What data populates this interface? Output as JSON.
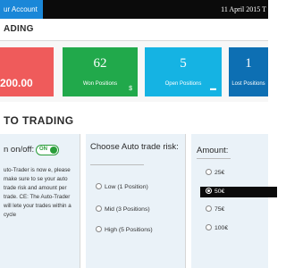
{
  "topbar": {
    "account_tab": "ur Account",
    "date": "11 April 2015 T"
  },
  "section1": {
    "title": "ADING"
  },
  "stats": {
    "balance": "200.00",
    "won": {
      "value": "62",
      "label": "Won Positions"
    },
    "open": {
      "value": "5",
      "label": "Open Positions"
    },
    "lost": {
      "value": "1",
      "label": "Lost Positions"
    }
  },
  "section2": {
    "title": "TO TRADING"
  },
  "autotrader": {
    "title": "n on/off:",
    "toggle_label": "ON",
    "text": "uto-Trader is now e, please make sure to se your auto trade risk and amount per trade. CE: The Auto-Trader will lete your trades within a cycle"
  },
  "risk": {
    "title": "Choose Auto trade risk:",
    "options": [
      {
        "label": "Low (1 Position)",
        "selected": false
      },
      {
        "label": "Mid (3 Positions)",
        "selected": false
      },
      {
        "label": "High (5 Positions)",
        "selected": false
      }
    ]
  },
  "amount": {
    "title": "Amount:",
    "options": [
      {
        "label": "25€",
        "selected": false
      },
      {
        "label": "50€",
        "selected": true
      },
      {
        "label": "75€",
        "selected": false
      },
      {
        "label": "100€",
        "selected": false
      }
    ]
  },
  "colors": {
    "account_tab": "#1a87d8",
    "red_card": "#ef5b5b",
    "green_card": "#21a94b",
    "blue_card": "#15b3e3",
    "navy_card": "#0d6fb3",
    "toggle_on": "#2a9d3a"
  },
  "icons": {
    "open": "folder-icon",
    "won": "dollar-icon",
    "lost": "circle-icon"
  }
}
